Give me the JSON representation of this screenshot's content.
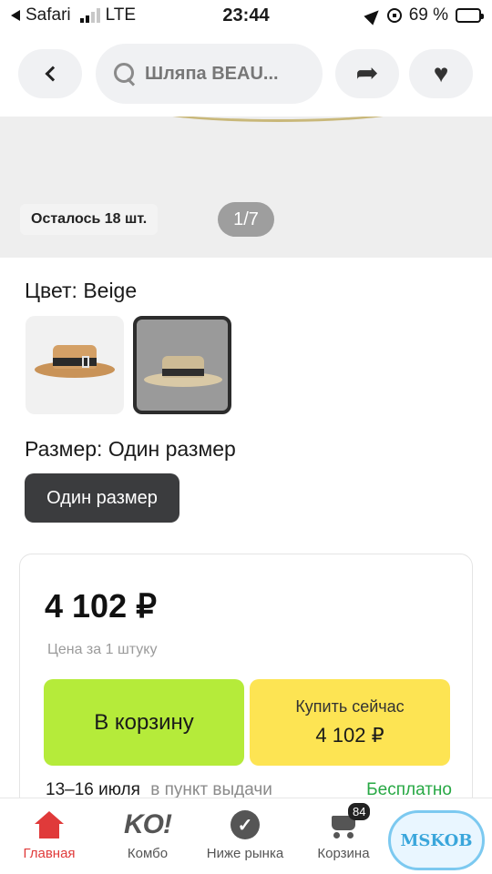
{
  "status_bar": {
    "back_app": "Safari",
    "network": "LTE",
    "time": "23:44",
    "battery": "69 %",
    "battery_level": 0.69
  },
  "top_nav": {
    "search_text": "Шляпа BEAU..."
  },
  "gallery": {
    "stock_text": "Осталось 18 шт.",
    "page_indicator": "1/7"
  },
  "product": {
    "color_label": "Цвет: Beige",
    "size_label": "Размер: Один размер",
    "size_option": "Один размер"
  },
  "price_card": {
    "price": "4 102 ₽",
    "per_unit": "Цена за 1 штуку",
    "cart_button": "В корзину",
    "buy_now_label": "Купить сейчас",
    "buy_now_price": "4 102 ₽",
    "delivery_dates": "13–16 июля",
    "delivery_where": "в пункт выдачи",
    "delivery_price": "Бесплатно"
  },
  "tabs": [
    {
      "label": "Главная",
      "icon": "home-icon",
      "active": true
    },
    {
      "label": "Комбо",
      "icon": "ko-logo-icon"
    },
    {
      "label": "Ниже рынка",
      "icon": "check-badge-icon"
    },
    {
      "label": "Корзина",
      "icon": "cart-icon",
      "badge": "84"
    }
  ],
  "tab_logo_text": "KO!",
  "watermark": "MSKOB",
  "colors": {
    "accent_red": "#e03a3a",
    "cart_green": "#b5eb3a",
    "buy_yellow": "#fde453",
    "free_green": "#27a844"
  }
}
